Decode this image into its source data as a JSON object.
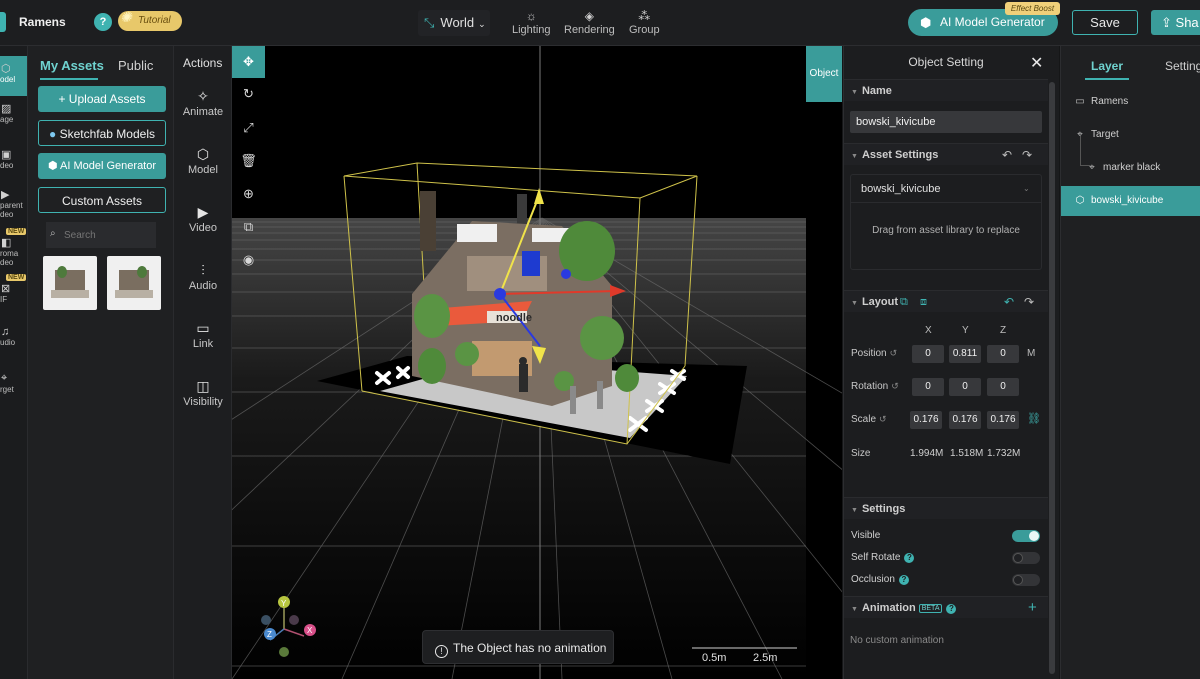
{
  "topbar": {
    "project_name": "Ramens",
    "help": "?",
    "tutorial": "Tutorial",
    "world": "World",
    "tools": [
      {
        "label": "Lighting",
        "icon": "sun-icon"
      },
      {
        "label": "Rendering",
        "icon": "paint-bucket-icon"
      },
      {
        "label": "Group",
        "icon": "group-icon"
      }
    ],
    "ai_model_generator": "AI Model Generator",
    "effect_badge": "Effect Boost",
    "save": "Save",
    "share": "Sha"
  },
  "rail": {
    "items": [
      "odel",
      "age",
      "deo",
      "parent deo",
      "roma deo",
      "IF",
      "udio",
      "rget"
    ],
    "new_badge": "NEW"
  },
  "assets": {
    "tab_my": "My Assets",
    "tab_public": "Public",
    "upload": "+ Upload Assets",
    "sketchfab": "Sketchfab Models",
    "ai_generator": "AI Model Generator",
    "custom": "Custom Assets",
    "search_placeholder": "Search"
  },
  "actions": {
    "title": "Actions",
    "items": [
      {
        "label": "Animate",
        "icon": "sparkle-icon"
      },
      {
        "label": "Model",
        "icon": "cube-icon"
      },
      {
        "label": "Video",
        "icon": "play-icon"
      },
      {
        "label": "Audio",
        "icon": "equalizer-icon"
      },
      {
        "label": "Link",
        "icon": "link-icon"
      },
      {
        "label": "Visibility",
        "icon": "visibility-icon"
      }
    ]
  },
  "viewport": {
    "object_tab": "Object",
    "toast": "The Object has no animation",
    "scale_small": "0.5m",
    "scale_large": "2.5m",
    "sign_text": "noodle",
    "gizmo_axes": [
      "Y",
      "Z",
      "X"
    ]
  },
  "object_setting": {
    "title": "Object Setting",
    "name_section": "Name",
    "name_value": "bowski_kivicube",
    "asset_section": "Asset Settings",
    "asset_value": "bowski_kivicube",
    "asset_hint": "Drag from asset library to replace",
    "layout_section": "Layout",
    "axes": [
      "X",
      "Y",
      "Z"
    ],
    "position_label": "Position",
    "position": [
      "0",
      "0.811",
      "0"
    ],
    "unit": "M",
    "rotation_label": "Rotation",
    "rotation": [
      "0",
      "0",
      "0"
    ],
    "scale_label": "Scale",
    "scale": [
      "0.176",
      "0.176",
      "0.176"
    ],
    "size_label": "Size",
    "size": [
      "1.994M",
      "1.518M",
      "1.732M"
    ],
    "settings_section": "Settings",
    "visible_label": "Visible",
    "visible": true,
    "self_rotate_label": "Self Rotate",
    "self_rotate": false,
    "occlusion_label": "Occlusion",
    "occlusion": false,
    "animation_section": "Animation",
    "beta": "BETA",
    "no_animation": "No custom animation"
  },
  "layer": {
    "tab_layer": "Layer",
    "tab_setting": "Setting",
    "items": [
      "Ramens",
      "Target",
      "marker black",
      "bowski_kivicube"
    ]
  },
  "colors": {
    "accent": "#3a9c9a",
    "accent_light": "#6fd2cf",
    "badge": "#e8c86a",
    "panel": "#1c1d1f"
  }
}
